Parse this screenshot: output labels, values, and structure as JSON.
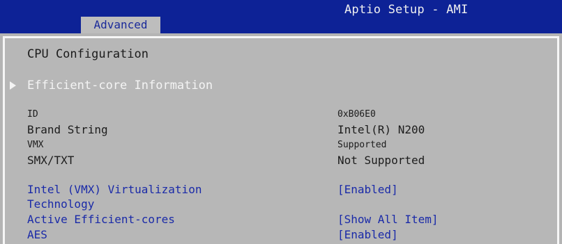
{
  "header": {
    "title": "Aptio Setup - AMI",
    "tabs": [
      {
        "label": "Advanced"
      }
    ]
  },
  "page": {
    "section_title": "CPU Configuration",
    "submenu": {
      "label": "Efficient-core Information",
      "icon": "triangle-right-icon"
    },
    "info": [
      {
        "label": "ID",
        "value": "0xB06E0"
      },
      {
        "label": "Brand String",
        "value": "Intel(R) N200"
      },
      {
        "label": "VMX",
        "value": "Supported"
      },
      {
        "label": "SMX/TXT",
        "value": "Not Supported"
      }
    ],
    "options": [
      {
        "label_line1": "Intel (VMX) Virtualization",
        "label_line2": "Technology",
        "value": "[Enabled]"
      },
      {
        "label": "Active Efficient-cores",
        "value": "[Show All Item]"
      },
      {
        "label": "AES",
        "value": "[Enabled]"
      }
    ]
  },
  "colors": {
    "header_bg": "#0d2296",
    "panel_bg": "#b7b7b7",
    "option_text": "#1a2aa8",
    "info_text": "#1c1c1c",
    "highlight_text": "#f4f4f4"
  }
}
